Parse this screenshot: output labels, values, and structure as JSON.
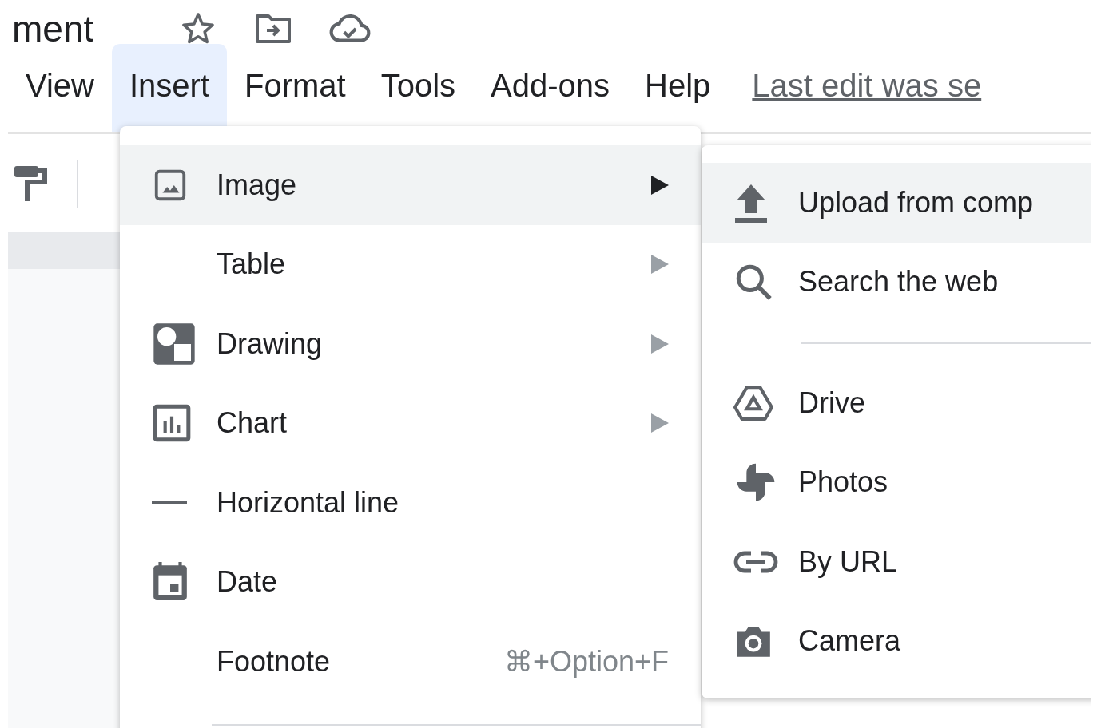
{
  "document_title": "ment",
  "menu_bar": [
    {
      "label": "View",
      "selected": false
    },
    {
      "label": "Insert",
      "selected": true
    },
    {
      "label": "Format",
      "selected": false
    },
    {
      "label": "Tools",
      "selected": false
    },
    {
      "label": "Add-ons",
      "selected": false
    },
    {
      "label": "Help",
      "selected": false
    }
  ],
  "last_edit": "Last edit was se",
  "insert_menu": {
    "items": [
      {
        "kind": "image",
        "label": "Image",
        "submenu": true,
        "selected": true
      },
      {
        "kind": "table",
        "label": "Table",
        "submenu": true,
        "selected": false
      },
      {
        "kind": "drawing",
        "label": "Drawing",
        "submenu": true,
        "selected": false
      },
      {
        "kind": "chart",
        "label": "Chart",
        "submenu": true,
        "selected": false
      },
      {
        "kind": "line",
        "label": "Horizontal line",
        "submenu": false,
        "selected": false
      },
      {
        "kind": "date",
        "label": "Date",
        "submenu": false,
        "selected": false
      },
      {
        "kind": "footnote",
        "label": "Footnote",
        "submenu": false,
        "selected": false,
        "shortcut": "⌘+Option+F"
      }
    ]
  },
  "image_submenu": {
    "items": [
      {
        "kind": "upload",
        "label": "Upload from comp",
        "selected": true
      },
      {
        "kind": "search",
        "label": "Search the web",
        "selected": false
      },
      {
        "kind": "divider"
      },
      {
        "kind": "drive",
        "label": "Drive",
        "selected": false
      },
      {
        "kind": "photos",
        "label": "Photos",
        "selected": false
      },
      {
        "kind": "link",
        "label": "By URL",
        "selected": false
      },
      {
        "kind": "camera",
        "label": "Camera",
        "selected": false
      }
    ]
  }
}
